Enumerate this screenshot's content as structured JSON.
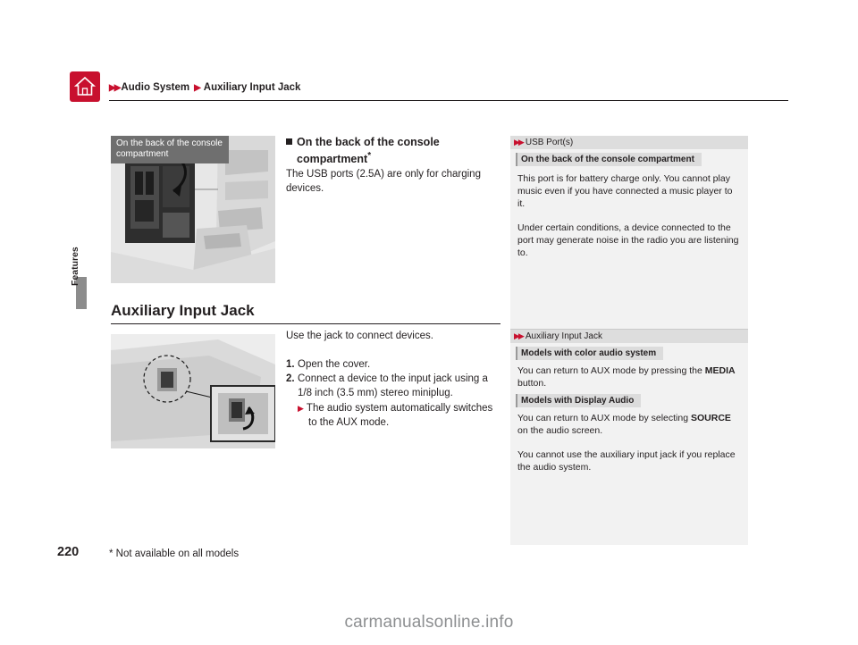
{
  "breadcrumb": {
    "item1": "Audio System",
    "item2": "Auxiliary Input Jack"
  },
  "side_tab_label": "Features",
  "page_number": "220",
  "footnote": "* Not available on all models",
  "figure1": {
    "caption": "On the back of the console compartment",
    "icon": "console-compartment-photo"
  },
  "figure2": {
    "icon": "auxiliary-input-jack-photo"
  },
  "section1": {
    "heading_line1": "On the back of the console",
    "heading_line2": "compartment",
    "heading_footnote": "*",
    "body": "The USB ports (2.5A) are only for charging devices."
  },
  "section2": {
    "title": "Auxiliary Input Jack",
    "intro": "Use the jack to connect devices.",
    "steps": [
      {
        "num": "1.",
        "text": "Open the cover."
      },
      {
        "num": "2.",
        "text": "Connect a device to the input jack using a",
        "cont": "1/8 inch (3.5 mm) stereo miniplug."
      }
    ],
    "substep": "The audio system automatically switches",
    "substep_cont": "to the AUX mode."
  },
  "sidebar": {
    "block1": {
      "title": "USB Port(s)",
      "tag": "On the back of the console compartment",
      "para1": "This port is for battery charge only.  You cannot play music even if you have connected a music player to it.",
      "para2": "Under certain conditions, a device connected to the port may generate noise in the radio you are listening to."
    },
    "block2": {
      "title": "Auxiliary Input Jack",
      "tag1": "Models with color audio system",
      "para1_a": "You can return to AUX mode by pressing the ",
      "para1_b": "MEDIA",
      "para1_c": " button.",
      "tag2": "Models with Display Audio",
      "para2_a": "You can return to AUX mode by selecting ",
      "para2_b": "SOURCE",
      "para2_c": " on the audio screen.",
      "para3": "You cannot use the auxiliary input jack if you replace the audio system."
    }
  },
  "watermark": "carmanualsonline.info",
  "colors": {
    "accent_red": "#c8102e",
    "caption_grey": "#6f6f6f",
    "sidebar_bg": "#f2f2f2",
    "tag_grey": "#dcdcdc"
  }
}
